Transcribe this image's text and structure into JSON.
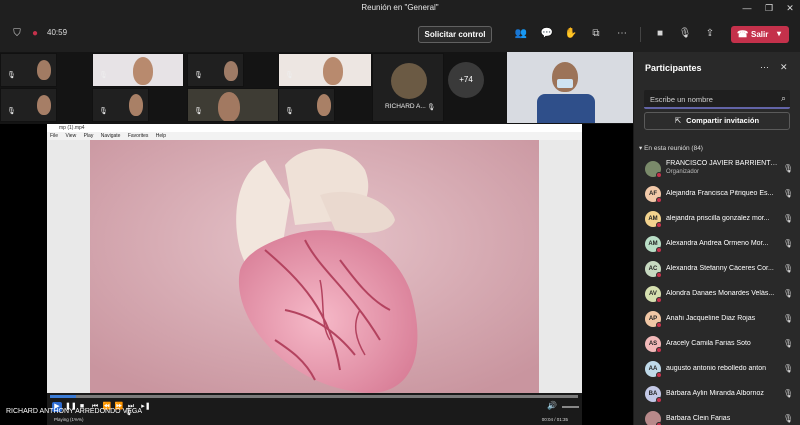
{
  "window": {
    "title": "Reunión en \"General\""
  },
  "toolbar": {
    "timer": "40:59",
    "request_control_label": "Solicitar control",
    "leave_label": "Salir"
  },
  "strip": {
    "overflow_count": "+74",
    "named_tile": "RICHARD A..."
  },
  "player": {
    "file_title": "mp (1).mp4",
    "menu": [
      "File",
      "View",
      "Play",
      "Navigate",
      "Favorites",
      "Help"
    ],
    "status": "Playing (1%%)",
    "timecode": "00:04 / 01:35",
    "progress": 0.05
  },
  "speaker": {
    "name": "RICHARD ANTHONY ARREDONDO VEGA"
  },
  "panel": {
    "title": "Participantes",
    "search_placeholder": "Escribe un nombre",
    "share_label": "Compartir invitación",
    "section_label": "En esta reunión (84)",
    "participants": [
      {
        "initials": "",
        "name": "FRANCISCO JAVIER BARRIENTOS ...",
        "role": "Organizador",
        "color": "#7a8a6a"
      },
      {
        "initials": "AF",
        "name": "Alejandra Francisca Pitriqueo Es...",
        "role": "",
        "color": "#f2c9a9"
      },
      {
        "initials": "AM",
        "name": "alejandra priscilla gonzalez mor...",
        "role": "",
        "color": "#f3d38e"
      },
      {
        "initials": "AM",
        "name": "Alexandra Andrea Ormeno Mor...",
        "role": "",
        "color": "#b9dec6"
      },
      {
        "initials": "AC",
        "name": "Alexandra Stefanny Cáceres Cor...",
        "role": "",
        "color": "#c7d9c1"
      },
      {
        "initials": "AV",
        "name": "Alondra Danaes Monardes Velás...",
        "role": "",
        "color": "#d6e0b0"
      },
      {
        "initials": "AP",
        "name": "Anahi Jacqueline Diaz Rojas",
        "role": "",
        "color": "#f1c7a5"
      },
      {
        "initials": "AS",
        "name": "Aracely Camila Farias Soto",
        "role": "",
        "color": "#f2b9b9"
      },
      {
        "initials": "AA",
        "name": "augusto antonio rebolledo anton",
        "role": "",
        "color": "#bfd9e9"
      },
      {
        "initials": "BA",
        "name": "Bárbara Aylin Miranda Albornoz",
        "role": "",
        "color": "#c3c8e6"
      },
      {
        "initials": "",
        "name": "Barbara Clein Farias",
        "role": "",
        "color": "#b8898a"
      }
    ]
  }
}
